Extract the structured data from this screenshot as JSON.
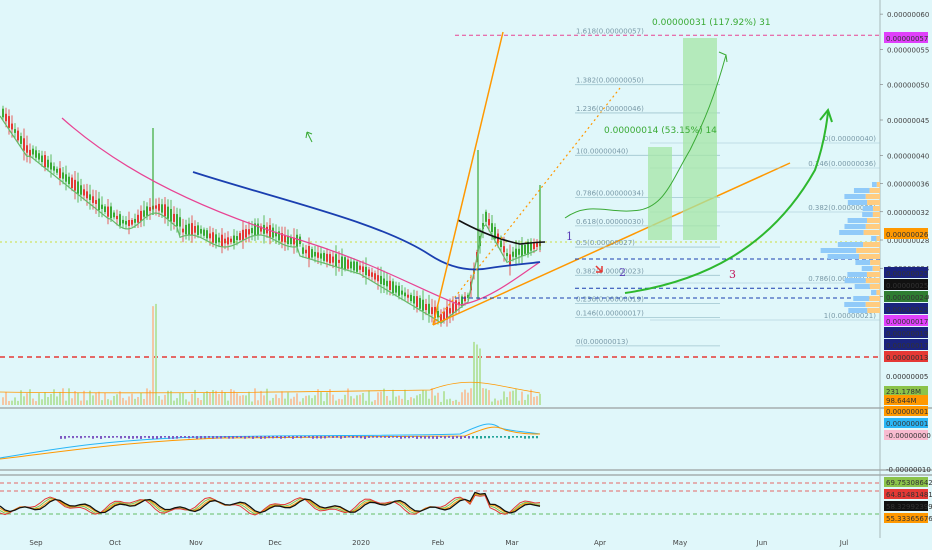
{
  "chart_data": {
    "type": "candlestick",
    "panes": [
      "price",
      "volume",
      "macd",
      "rsi"
    ],
    "x_axis": {
      "labels": [
        "Sep",
        "Oct",
        "Nov",
        "Dec",
        "2020",
        "Feb",
        "Mar",
        "Apr",
        "May",
        "Jun",
        "Jul"
      ]
    },
    "y_axis": {
      "labels": [
        "0.00000060",
        "0.00000055",
        "0.00000050",
        "0.00000045",
        "0.00000040",
        "0.00000036",
        "0.00000032",
        "0.00000028",
        "0.00000024",
        "0.00000020"
      ],
      "range": [
        1.1e-07,
        6.2e-07
      ]
    },
    "price_badges": [
      {
        "text": "0.00000057",
        "color": "#e040fb",
        "value": 5.7e-07
      },
      {
        "text": "0.00000026",
        "color": "#ff9800",
        "value": 2.6e-07
      },
      {
        "text": "0.00000025",
        "color": "#1a237e",
        "value": 2.53e-07
      },
      {
        "text": "0.00000025",
        "color": "#111111",
        "value": 2.48e-07
      },
      {
        "text": "0.00000024",
        "color": "#2e7d32",
        "value": 2.41e-07
      },
      {
        "text": "0.00000022",
        "color": "#1a237e",
        "value": 2.2e-07
      },
      {
        "text": "0.00000017",
        "color": "#e040fb",
        "value": 1.7e-07
      },
      {
        "text": "0.00000019",
        "color": "#1a237e",
        "value": 1.52e-07
      },
      {
        "text": "0.00000017",
        "color": "#1a237e",
        "value": 1.35e-07
      },
      {
        "text": "0.00000013",
        "color": "#e53935",
        "value": 1.2e-07
      }
    ],
    "fib_levels": [
      {
        "label": "1.618(0.00000057)",
        "value": 5.7e-07
      },
      {
        "label": "1.382(0.00000050)",
        "value": 5e-07
      },
      {
        "label": "1.236(0.00000046)",
        "value": 4.6e-07
      },
      {
        "label": "1(0.00000040)",
        "value": 4e-07
      },
      {
        "label": "0.786(0.00000034)",
        "value": 3.4e-07
      },
      {
        "label": "0.618(0.00000030)",
        "value": 3e-07
      },
      {
        "label": "0.5(0.00000027)",
        "value": 2.7e-07
      },
      {
        "label": "0.382(0.00000023)",
        "value": 2.3e-07
      },
      {
        "label": "0.236(0.00000019)",
        "value": 1.9e-07
      },
      {
        "label": "0.146(0.00000017)",
        "value": 1.7e-07
      },
      {
        "label": "0(0.00000013)",
        "value": 1.3e-07
      }
    ],
    "fib_right_labels": [
      "0(0.00000040)",
      "0.146(0.00000036)",
      "0.382(0.00000032)",
      "0.786(0.00000025)",
      "1(0.00000021)"
    ],
    "measurements": [
      {
        "text": "0.00000031 (117.92%) 31"
      },
      {
        "text": "0.00000014 (53.15%) 14"
      }
    ],
    "wave_labels": [
      "1",
      "2",
      "3"
    ],
    "volume_axis": {
      "labels": [
        "231.178M",
        "98.644M"
      ],
      "colors": [
        "#8bc34a",
        "#ff9800"
      ]
    },
    "macd_axis": {
      "labels": [
        "0.00000005",
        "0.00000001",
        "0.00000001",
        "-0.00000000",
        "-0.00000010"
      ],
      "colors": [
        "",
        "#ff9800",
        "#29b6f6",
        "#f8bbd0",
        ""
      ]
    },
    "rsi_axis": {
      "labels": [
        "69.75308642",
        "64.81481481",
        "58.32992399",
        "55.33365676"
      ],
      "colors": [
        "#8bc34a",
        "#e53935",
        "#111111",
        "#ff9800"
      ]
    },
    "colors": {
      "background": "#e0f7fa",
      "up_candle": "#3aaa35",
      "down_candle": "#e53935",
      "ema_blue": "#1a3fb0",
      "ma_pink": "#e84393",
      "ma_black": "#111111",
      "orange_trend": "#ff9800",
      "green_projection": "#3aaa35",
      "fib_line": "#9fc5cf"
    }
  }
}
